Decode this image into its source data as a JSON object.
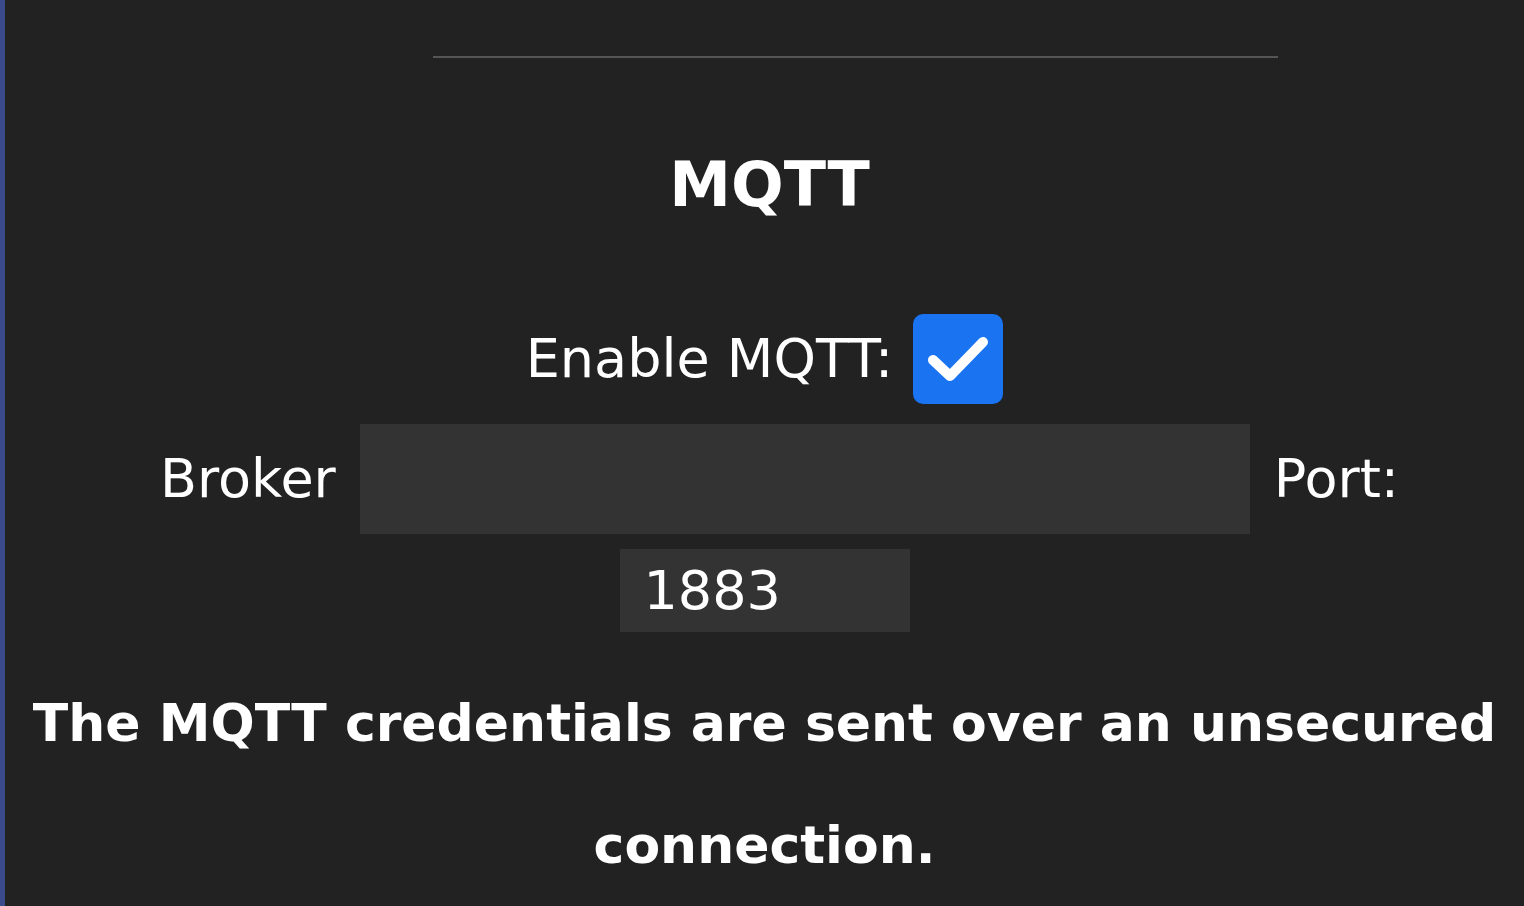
{
  "title": "MQTT",
  "enable": {
    "label": "Enable MQTT:",
    "checked": true
  },
  "broker": {
    "label": "Broker"
  },
  "port": {
    "label": "Port:",
    "value": "1883"
  },
  "notice": "The MQTT credentials are sent over an unsecured connection."
}
